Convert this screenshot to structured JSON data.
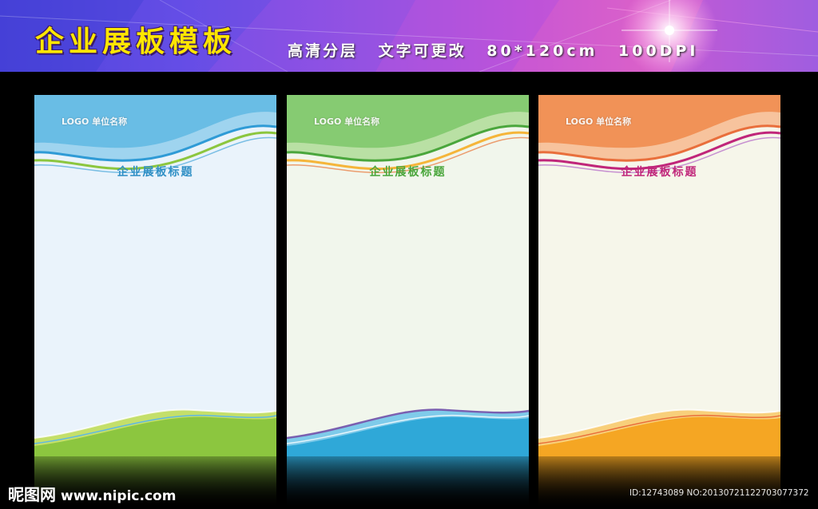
{
  "banner": {
    "title": "企业展板模板",
    "subtitle_parts": [
      "高清分层",
      "文字可更改",
      "80*120cm",
      "100DPI"
    ]
  },
  "boards": [
    {
      "logo": "LOGO 单位名称",
      "title": "企业展板标题",
      "theme": "blue",
      "colors": {
        "bg": "#eaf3fb",
        "top": "#5fb8e3",
        "title": "#2f8fc5",
        "bottom1": "#8cc63f",
        "bottom2": "#c4df6a"
      }
    },
    {
      "logo": "LOGO 单位名称",
      "title": "企业展板标题",
      "theme": "green",
      "colors": {
        "bg": "#f1f6ec",
        "top": "#7cc76a",
        "title": "#4aa63c",
        "bottom1": "#2fa8d8",
        "bottom2": "#7a5fb0"
      }
    },
    {
      "logo": "LOGO 单位名称",
      "title": "企业展板标题",
      "theme": "orange",
      "colors": {
        "bg": "#f6f6ea",
        "top": "#f08a4b",
        "title": "#c0267a",
        "bottom1": "#f5a623",
        "bottom2": "#e96f3c"
      }
    }
  ],
  "watermark": {
    "brand": "昵图网",
    "url": "www.nipic.com",
    "id_text": "ID:12743089 NO:20130721122703077372"
  }
}
